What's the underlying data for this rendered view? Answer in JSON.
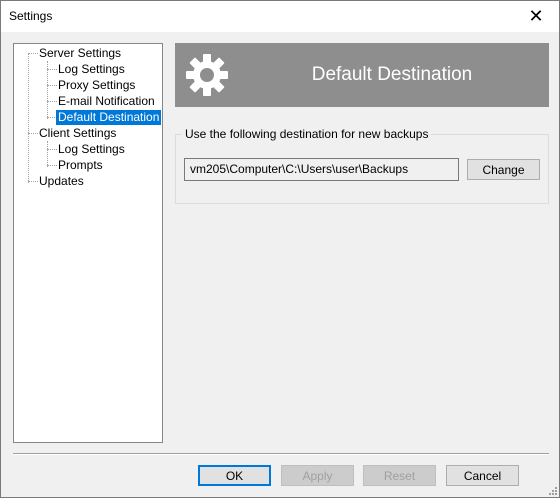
{
  "window": {
    "title": "Settings",
    "close_glyph": "✕"
  },
  "tree": {
    "items": [
      {
        "label": "Server Settings"
      },
      {
        "label": "Log Settings"
      },
      {
        "label": "Proxy Settings"
      },
      {
        "label": "E-mail Notification"
      },
      {
        "label": "Default Destination",
        "selected": true
      },
      {
        "label": "Client Settings"
      },
      {
        "label": "Log Settings"
      },
      {
        "label": "Prompts"
      },
      {
        "label": "Updates"
      }
    ]
  },
  "header": {
    "title": "Default Destination",
    "icon": "gear-icon",
    "background": "#8e8e8e"
  },
  "destination": {
    "group_label": "Use the following destination for new backups",
    "path": "vm205\\Computer\\C:\\Users\\user\\Backups",
    "change_label": "Change"
  },
  "footer": {
    "ok_label": "OK",
    "apply_label": "Apply",
    "reset_label": "Reset",
    "cancel_label": "Cancel"
  },
  "colors": {
    "selection": "#0078d7",
    "accent_border": "#0078d7"
  }
}
